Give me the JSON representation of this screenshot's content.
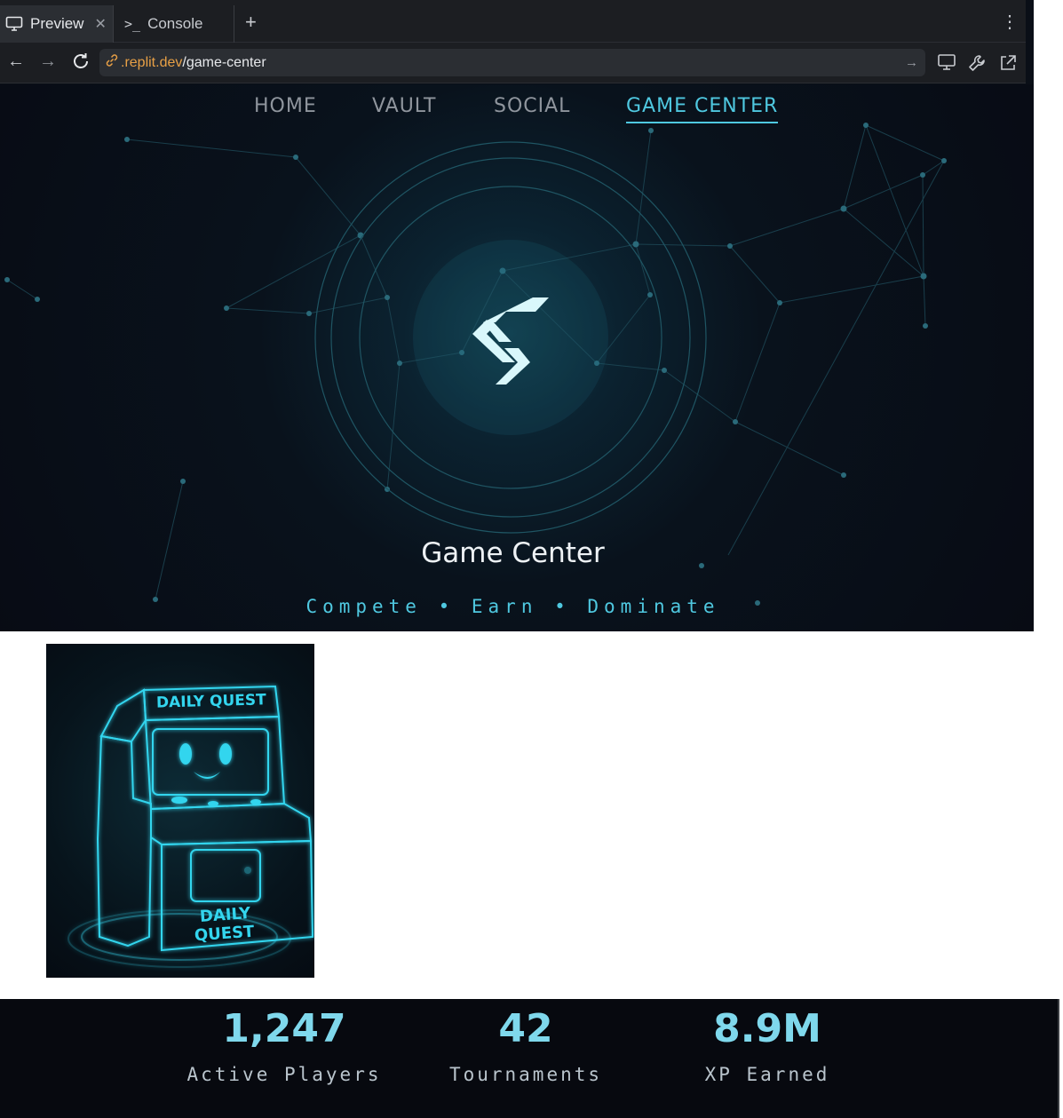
{
  "browser": {
    "tabs": [
      {
        "label": "Preview",
        "icon": "monitor-icon",
        "active": true
      },
      {
        "label": "Console",
        "icon": "terminal-icon",
        "active": false
      }
    ],
    "address": {
      "host": ".replit.dev",
      "path": "/game-center"
    }
  },
  "nav": {
    "items": [
      {
        "label": "HOME",
        "active": false
      },
      {
        "label": "VAULT",
        "active": false
      },
      {
        "label": "SOCIAL",
        "active": false
      },
      {
        "label": "GAME CENTER",
        "active": true
      }
    ]
  },
  "hero": {
    "title": "Game Center",
    "tagline": "Compete • Earn • Dominate",
    "accent": "#4fc8e0"
  },
  "quest": {
    "marquee": "DAILY QUEST",
    "panel_line1": "DAILY",
    "panel_line2": "QUEST"
  },
  "stats": [
    {
      "value": "1,247",
      "label": "Active Players"
    },
    {
      "value": "42",
      "label": "Tournaments"
    },
    {
      "value": "8.9M",
      "label": "XP Earned"
    }
  ]
}
